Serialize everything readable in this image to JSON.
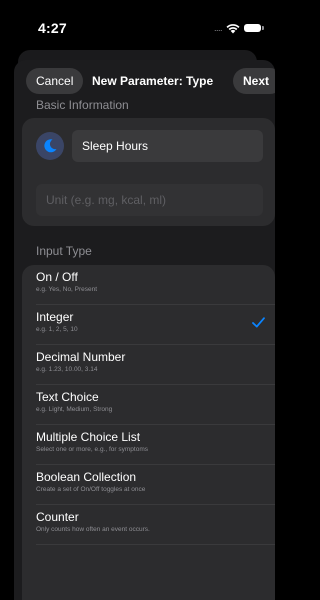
{
  "status_bar": {
    "time": "4:27",
    "signal": "....",
    "icons": [
      "wifi-icon",
      "battery-icon"
    ]
  },
  "nav": {
    "cancel_label": "Cancel",
    "title": "New Parameter: Type",
    "next_label": "Next"
  },
  "basic_info": {
    "header": "Basic Information",
    "icon": "moon-icon",
    "name_value": "Sleep Hours",
    "unit_placeholder": "Unit (e.g. mg, kcal, ml)"
  },
  "input_type": {
    "header": "Input Type",
    "selected": "Integer",
    "options": [
      {
        "title": "On / Off",
        "subtitle": "e.g. Yes, No, Present"
      },
      {
        "title": "Integer",
        "subtitle": "e.g. 1, 2, 5, 10"
      },
      {
        "title": "Decimal Number",
        "subtitle": "e.g. 1.23, 10.00, 3.14"
      },
      {
        "title": "Text Choice",
        "subtitle": "e.g. Light, Medium, Strong"
      },
      {
        "title": "Multiple Choice List",
        "subtitle": "Select one or more, e.g., for symptoms"
      },
      {
        "title": "Boolean Collection",
        "subtitle": "Create a set of On/Off toggles at once"
      },
      {
        "title": "Counter",
        "subtitle": "Only counts how often an event occurs."
      }
    ]
  },
  "colors": {
    "accent": "#0a84ff",
    "background": "#000000",
    "card": "#2c2c2e",
    "sheet": "#1c1c1e",
    "secondary_text": "#8e8e93"
  }
}
